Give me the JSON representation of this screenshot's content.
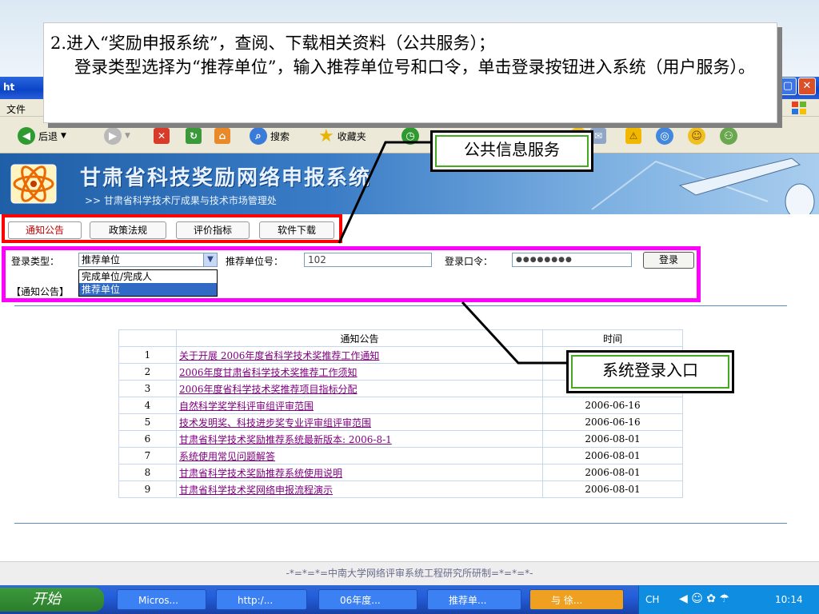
{
  "annotation": {
    "line1": "2.进入“奖励申报系统”，查阅、下载相关资料（公共服务）；",
    "line2": "登录类型选择为“推荐单位”，输入推荐单位号和口令，单击登录按钮进入系统（用户服务）。",
    "callout_public": "公共信息服务",
    "callout_login": "系统登录入口"
  },
  "browser": {
    "title_fragment": "ht",
    "menu_fragment": "文件",
    "toolbar": {
      "back": "后退",
      "search": "搜索",
      "favorites": "收藏夹"
    }
  },
  "banner": {
    "title": "甘肃省科技奖励网络申报系统",
    "subtitle": ">> 甘肃省科学技术厅成果与技术市场管理处"
  },
  "tabs": [
    {
      "label": "通知公告",
      "active": true
    },
    {
      "label": "政策法规",
      "active": false
    },
    {
      "label": "评价指标",
      "active": false
    },
    {
      "label": "软件下载",
      "active": false
    }
  ],
  "login": {
    "type_label": "登录类型：",
    "type_value": "推荐单位",
    "options": [
      "完成单位/完成人",
      "推荐单位"
    ],
    "selected_option": "推荐单位",
    "unit_label": "推荐单位号：",
    "unit_value": "102",
    "password_label": "登录口令：",
    "password_value": "●●●●●●●●",
    "button": "登录"
  },
  "notices_label": "【通知公告】",
  "notices": {
    "headers": [
      "",
      "通知公告",
      "时间"
    ],
    "rows": [
      {
        "num": "1",
        "title": "关于开展 2006年度省科学技术奖推荐工作通知",
        "date": ""
      },
      {
        "num": "2",
        "title": "2006年度甘肃省科学技术奖推荐工作须知",
        "date": ""
      },
      {
        "num": "3",
        "title": "2006年度省科学技术奖推荐项目指标分配",
        "date": ""
      },
      {
        "num": "4",
        "title": "自然科学奖学科评审组评审范围",
        "date": "2006-06-16"
      },
      {
        "num": "5",
        "title": "技术发明奖、科技进步奖专业评审组评审范围",
        "date": "2006-06-16"
      },
      {
        "num": "6",
        "title": "甘肃省科学技术奖励推荐系统最新版本: 2006-8-1",
        "date": "2006-08-01"
      },
      {
        "num": "7",
        "title": "系统使用常见问题解答",
        "date": "2006-08-01"
      },
      {
        "num": "8",
        "title": "甘肃省科学技术奖励推荐系统使用说明",
        "date": "2006-08-01"
      },
      {
        "num": "9",
        "title": "甘肃省科学技术奖网络申报流程演示",
        "date": "2006-08-01"
      }
    ]
  },
  "footer": "-*=*=*=中南大学网络评审系统工程研究所研制=*=*=*-",
  "taskbar": {
    "start": "开始",
    "tasks": [
      "Micros...",
      "http:/...",
      "06年度...",
      "推荐单...",
      "与 徐..."
    ],
    "lang": "CH",
    "clock": "10:14"
  }
}
